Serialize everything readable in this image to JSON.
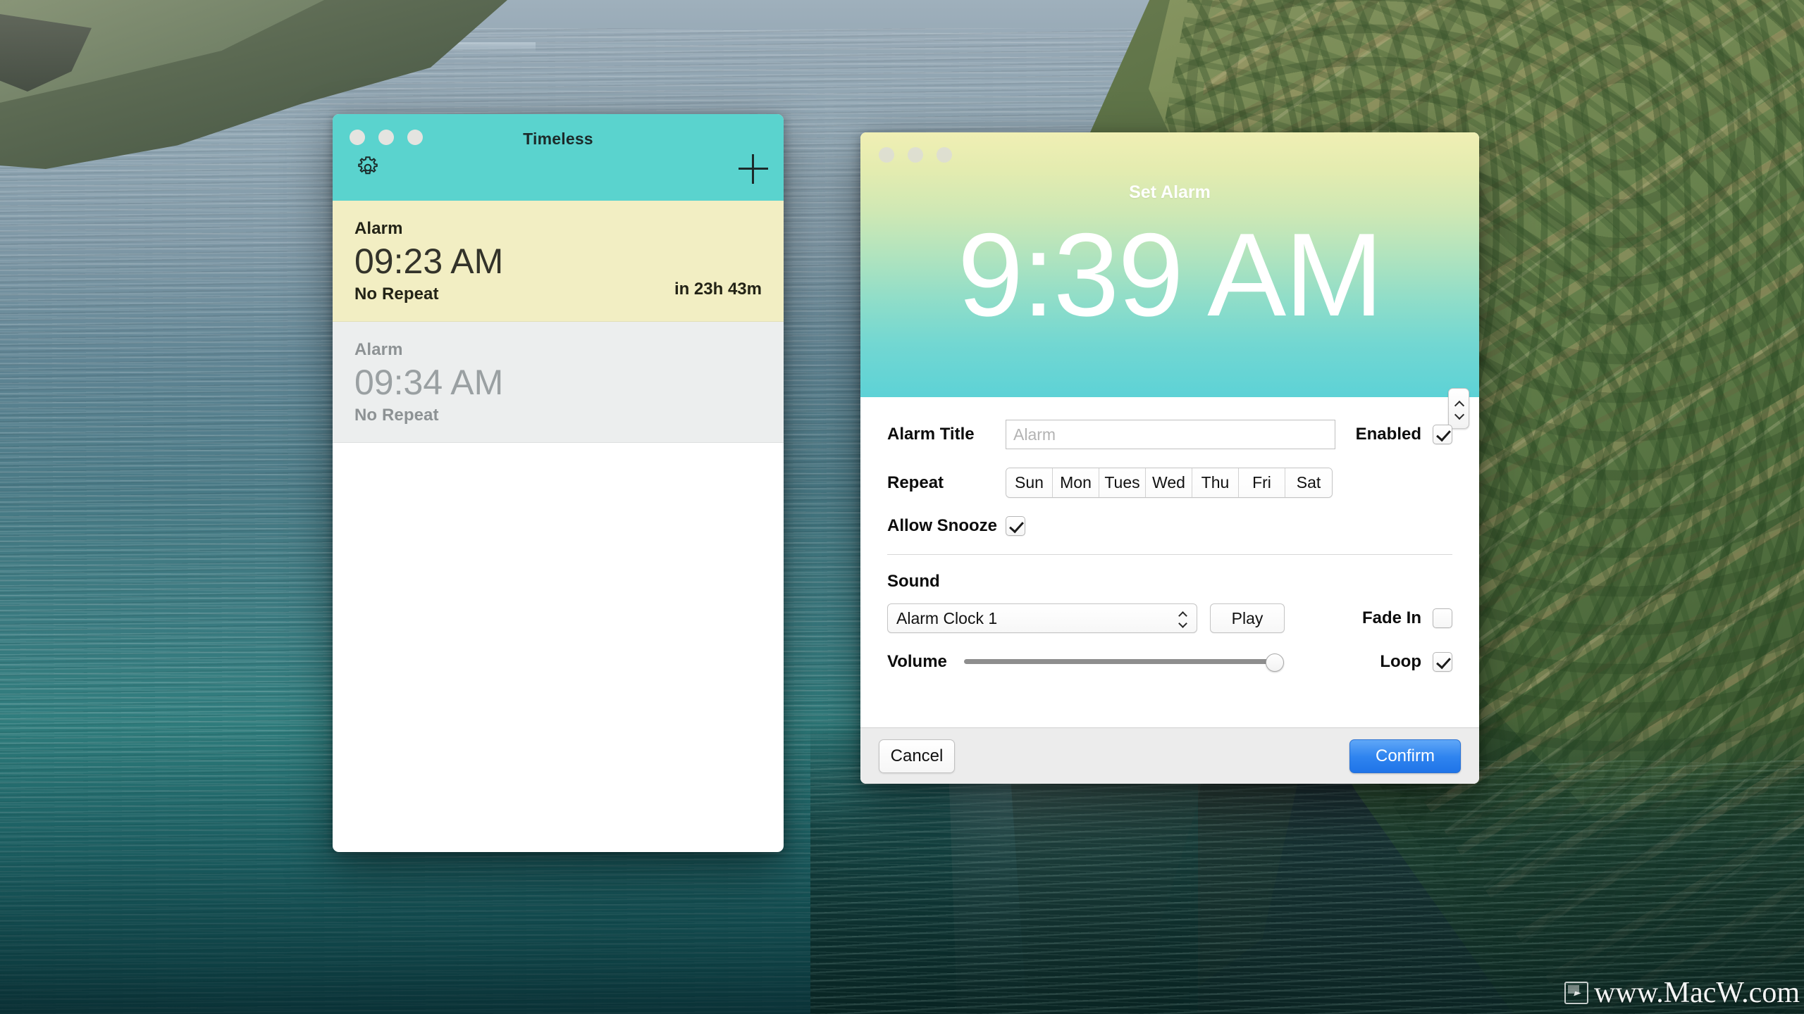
{
  "desktop": {
    "wallpaper_description": "coastal cliff and ocean photograph",
    "watermark": "www.MacW.com"
  },
  "main_window": {
    "title": "Timeless",
    "icons": {
      "settings": "gear-icon",
      "add": "plus-icon"
    },
    "traffic_lights": [
      "close",
      "minimize",
      "zoom"
    ],
    "alarms": [
      {
        "name": "Alarm",
        "time": "09:23 AM",
        "repeat": "No Repeat",
        "countdown": "in 23h 43m",
        "enabled": true
      },
      {
        "name": "Alarm",
        "time": "09:34 AM",
        "repeat": "No Repeat",
        "countdown": "",
        "enabled": false
      }
    ]
  },
  "dialog": {
    "title": "Set Alarm",
    "time": "9:39 AM",
    "stepper": "time-stepper",
    "fields": {
      "alarm_title_label": "Alarm Title",
      "alarm_title_value": "",
      "alarm_title_placeholder": "Alarm",
      "enabled_label": "Enabled",
      "enabled_checked": true,
      "repeat_label": "Repeat",
      "days": [
        "Sun",
        "Mon",
        "Tues",
        "Wed",
        "Thu",
        "Fri",
        "Sat"
      ],
      "allow_snooze_label": "Allow Snooze",
      "allow_snooze_checked": true
    },
    "sound": {
      "section_label": "Sound",
      "selected": "Alarm Clock 1",
      "play_label": "Play",
      "fade_in_label": "Fade In",
      "fade_in_checked": false,
      "volume_label": "Volume",
      "volume_percent": 100,
      "loop_label": "Loop",
      "loop_checked": true
    },
    "footer": {
      "cancel_label": "Cancel",
      "confirm_label": "Confirm"
    }
  },
  "colors": {
    "header_teal": "#5ad3ce",
    "alarm_active_bg": "#f2eec3",
    "alarm_inactive_bg": "#eceeee",
    "confirm_blue": "#2f84ef",
    "hero_gradient_top": "#f0efb4",
    "hero_gradient_bottom": "#5dd2d6"
  }
}
